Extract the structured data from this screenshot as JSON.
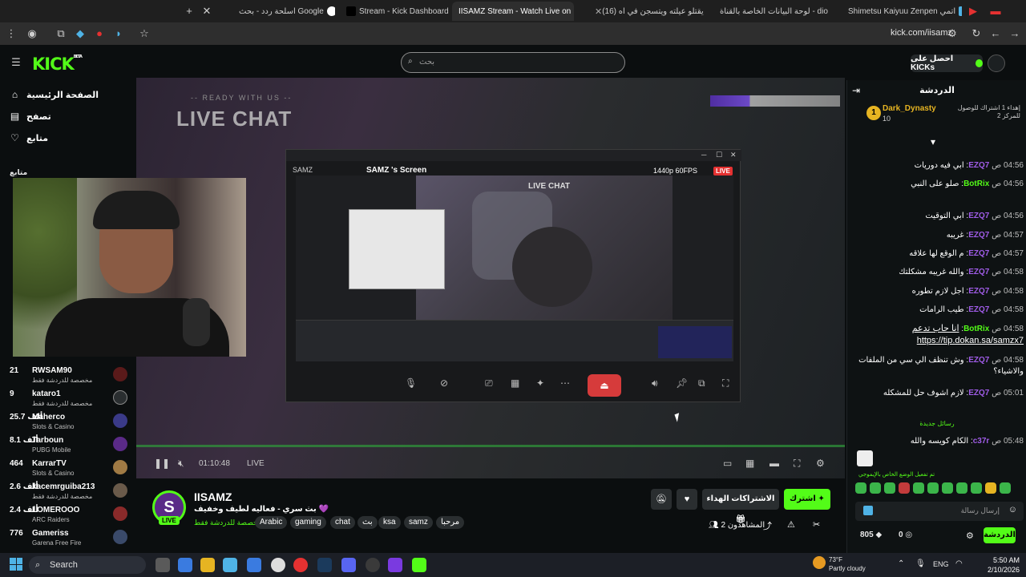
{
  "browser": {
    "tabs": [
      {
        "label": "اسلحة ردد - بحث Google",
        "fav": "#ffffff"
      },
      {
        "label": "Stream - Kick Dashboard",
        "fav": "#53fc18"
      },
      {
        "label": "IISAMZ Stream - Watch Live on",
        "fav": "#53fc18",
        "active": true
      },
      {
        "label": "(16) يقتلو عيلته ويتسجن في اه",
        "fav": "#e53131"
      },
      {
        "label": "لوحة البيانات الخاصة بالقناة - dio",
        "fav": "#e53131"
      },
      {
        "label": "Shimetsu Kaiyuu Zenpen اتمي",
        "fav": "#4fb3e6"
      }
    ],
    "url": "kick.com/iisamz"
  },
  "header": {
    "logo": "KICK",
    "logo_beta": "BETA",
    "search_placeholder": "بحث",
    "get_kicks": "احصل على KICKs"
  },
  "sidebar": {
    "nav": [
      {
        "label": "الصفحة الرئيسية",
        "icon": "home-icon"
      },
      {
        "label": "تصفح",
        "icon": "browse-icon"
      },
      {
        "label": "متابع",
        "icon": "heart-icon"
      }
    ],
    "following_label": "متابع",
    "channels": [
      {
        "count": "21",
        "name": "RWSAM90",
        "game": "مخصصة للدردشة فقط",
        "color": "#5a1a1a"
      },
      {
        "count": "9",
        "name": "kataro1",
        "game": "مخصصة للدردشة فقط",
        "color": "#2a2e30"
      },
      {
        "count": "25.7 ألف",
        "name": "Maherco",
        "game": "Slots & Casino",
        "color": "#3a3a88"
      },
      {
        "count": "8.1 ألف",
        "name": "Tarboun",
        "game": "PUBG Mobile",
        "color": "#5a2a87"
      },
      {
        "count": "464",
        "name": "KarrarTV",
        "game": "Slots & Casino",
        "color": "#a07a44"
      },
      {
        "count": "2.6 ألف",
        "name": "kacemrguiba213",
        "game": "مخصصة للدردشة فقط",
        "color": "#6a5a4a"
      },
      {
        "count": "2.4 ألف",
        "name": "LOMEROOO",
        "game": "ARC Raiders",
        "color": "#8a2a2a"
      },
      {
        "count": "776",
        "name": "Gameriss",
        "game": "Garena Free Fire",
        "color": "#3a4a6a"
      }
    ]
  },
  "video": {
    "overlay_small": "-- READY WITH US --",
    "overlay_title": "LIVE CHAT",
    "elapsed": "01:10:48",
    "live_label": "LIVE",
    "share": {
      "owner": "SAMZ",
      "title": "SAMZ 's Screen",
      "quality": "1440p 60FPS",
      "live": "LIVE",
      "preview_title": "LIVE CHAT"
    }
  },
  "channel": {
    "avatar_letter": "S",
    "live": "LIVE",
    "name": "IISAMZ",
    "title": "بث سري - فعاليه لطيف وخفيف 💜",
    "category": "مخصصة للدردشة فقط",
    "tags": [
      "Arabic",
      "gaming",
      "chat",
      "بث",
      "ksa",
      "samz",
      "مرحبا"
    ],
    "subscribe": "اشترك",
    "gift_subs": "الاشتراكات الهداء",
    "viewers_label": "المشاهدون",
    "viewers": "2"
  },
  "chat": {
    "title": "الدردشة",
    "pinned": {
      "user": "Dark_Dynasty",
      "level": "10",
      "text": "إهداء 1 اشتراك للوصول للمركز 2"
    },
    "messages": [
      {
        "time": "04:56 ص",
        "user": "EZQ7",
        "text": "ابي فيه دوريات",
        "bot": false
      },
      {
        "time": "04:56 ص",
        "user": "BotRix",
        "text": "صلو على النبي",
        "bot": true
      },
      {
        "time": "04:56 ص",
        "user": "EZQ7",
        "text": "ابي التوقيت",
        "bot": false
      },
      {
        "time": "04:57 ص",
        "user": "EZQ7",
        "text": "غريبه",
        "bot": false
      },
      {
        "time": "04:57 ص",
        "user": "EZQ7",
        "text": "م الوقع لها علاقه",
        "bot": false
      },
      {
        "time": "04:58 ص",
        "user": "EZQ7",
        "text": "والله غريبه مشكلتك",
        "bot": false
      },
      {
        "time": "04:58 ص",
        "user": "EZQ7",
        "text": "اجل لازم تطوره",
        "bot": false
      },
      {
        "time": "04:58 ص",
        "user": "EZQ7",
        "text": "طيب الرامات",
        "bot": false
      },
      {
        "time": "04:58 ص",
        "user": "BotRix",
        "text": "انا حاب تدعم https://tip.dokan.sa/samzx7",
        "bot": true
      },
      {
        "time": "04:58 ص",
        "user": "EZQ7",
        "text": "وش تنظف الي سي من الملفات والاشياء؟",
        "bot": false
      },
      {
        "time": "05:01 ص",
        "user": "EZQ7",
        "text": "لازم اشوف حل للمشكله",
        "bot": false
      },
      {
        "time": "05:48 ص",
        "user": "c37r",
        "text": "الكام كويسه والله",
        "bot": false
      }
    ],
    "new_messages": "رسائل جديدة",
    "emote_mode": "تم تفعيل الوضع الخاص بالإيموجي",
    "input_placeholder": "إرسال رسالة",
    "kicks": "805",
    "points": "0",
    "send": "الدردشة"
  },
  "taskbar": {
    "search": "Search",
    "weather_temp": "73°F",
    "weather_desc": "Partly cloudy",
    "lang": "ENG",
    "time": "5:50 AM",
    "date": "2/10/2026"
  }
}
